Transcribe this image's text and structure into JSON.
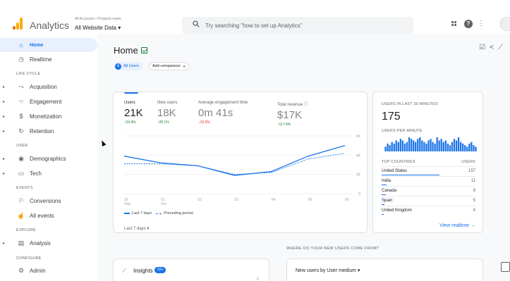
{
  "topbar": {
    "app_title": "Analytics",
    "account_crumb": "All Accounts > Property name",
    "account_name": "All Website Data",
    "search_placeholder": "Try searching \"how to set up Analytics\"",
    "icons": [
      "apps-grid-icon",
      "help-icon",
      "more-vert-icon",
      "avatar"
    ]
  },
  "sidebar": {
    "items": [
      {
        "label": "Home",
        "icon": "home-icon",
        "active": true
      },
      {
        "label": "Realtime",
        "icon": "clock-icon"
      },
      {
        "label": "Acquisition",
        "icon": "acquisition-icon"
      },
      {
        "label": "Engagement",
        "icon": "engagement-icon"
      },
      {
        "label": "Monetization",
        "icon": "dollar-icon"
      },
      {
        "label": "Retention",
        "icon": "retention-icon"
      },
      {
        "label": "Demographics",
        "icon": "globe-icon"
      },
      {
        "label": "Tech",
        "icon": "tech-icon"
      },
      {
        "label": "Conversions",
        "icon": "flag-icon"
      },
      {
        "label": "All events",
        "icon": "touch-icon"
      },
      {
        "label": "Analysis",
        "icon": "analysis-icon"
      },
      {
        "label": "Admin",
        "icon": "gear-icon"
      }
    ],
    "sections": [
      "LIFE CYCLE",
      "USER",
      "EVENTS",
      "EXPLORE",
      "CONFIGURE"
    ]
  },
  "page": {
    "title": "Home",
    "chip_all_users": "All Users",
    "chip_all_users_badge": "A",
    "chip_add_comparison": "Add comparison"
  },
  "metrics": [
    {
      "label": "Users",
      "value": "21K",
      "delta": "↑24.4%",
      "dir": "up"
    },
    {
      "label": "New users",
      "value": "18K",
      "delta": "↑28.1%",
      "dir": "up"
    },
    {
      "label": "Average engagement time",
      "value": "0m 41s",
      "delta": "↓19.5%",
      "dir": "down"
    },
    {
      "label": "Total revenue ⓘ",
      "value": "$17K",
      "delta": "↑117.6%",
      "dir": "up"
    }
  ],
  "legend": {
    "current": "Last 7 days",
    "previous": "Preceding period"
  },
  "date_range": "Last 7 days ▾",
  "chart_data": {
    "type": "line",
    "x": [
      "30 Sep",
      "01 Oct",
      "02",
      "03",
      "04",
      "05",
      "06"
    ],
    "x_top": [
      "30",
      "01",
      "02",
      "03",
      "04",
      "05",
      "06"
    ],
    "x_bottom": [
      "Sep",
      "Oct",
      "",
      "",
      "",
      "",
      ""
    ],
    "yticks": [
      "6K",
      "4K",
      "2K",
      "0"
    ],
    "ylim": [
      0,
      6000
    ],
    "series": [
      {
        "name": "Last 7 days",
        "values": [
          3900,
          3200,
          2900,
          1900,
          2300,
          3900,
          5000
        ],
        "style": "solid"
      },
      {
        "name": "Preceding period",
        "values": [
          3100,
          3100,
          2900,
          2000,
          2200,
          3600,
          4200
        ],
        "style": "dashed"
      }
    ],
    "color": "#1a73e8"
  },
  "realtime": {
    "title": "USERS IN LAST 30 MINUTES",
    "value": "175",
    "per_minute_label": "USERS PER MINUTE",
    "bars": [
      3,
      5,
      4,
      6,
      5,
      7,
      6,
      8,
      7,
      5,
      6,
      9,
      8,
      7,
      6,
      8,
      9,
      7,
      6,
      5,
      7,
      8,
      6,
      5,
      9,
      7,
      8,
      6,
      7,
      5,
      4,
      6,
      8,
      7,
      9,
      6,
      5,
      4,
      3,
      5,
      6,
      4,
      3
    ],
    "table_header": [
      "TOP COUNTRIES",
      "USERS"
    ],
    "rows": [
      {
        "country": "United States",
        "users": "157",
        "share": 0.9
      },
      {
        "country": "India",
        "users": "11",
        "share": 0.07
      },
      {
        "country": "Canada",
        "users": "9",
        "share": 0.06
      },
      {
        "country": "Spain",
        "users": "5",
        "share": 0.04
      },
      {
        "country": "United Kingdom",
        "users": "4",
        "share": 0.03
      }
    ],
    "link": "View realtime →"
  },
  "bottom": {
    "where_heading": "WHERE DO YOUR NEW USERS COME FROM?",
    "insights_label": "Insights",
    "insights_badge": "10+",
    "new_users_select": "New users by User medium ▾"
  }
}
